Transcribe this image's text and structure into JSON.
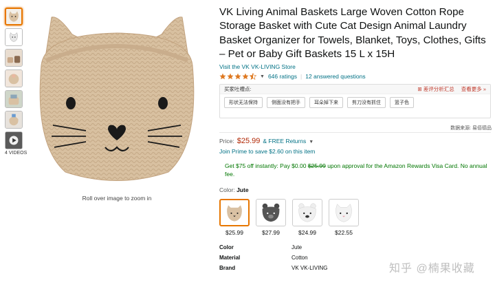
{
  "thumbnails": {
    "count": 6,
    "video_label": "4 VIDEOS"
  },
  "main": {
    "zoom_hint": "Roll over image to zoom in"
  },
  "product": {
    "title": "VK Living Animal Baskets Large Woven Cotton Rope Storage Basket with Cute Cat Design Animal Laundry Basket Organizer for Towels, Blanket, Toys, Clothes, Gifts – Pet or Baby Gift Baskets 15 L x 15H",
    "store_link": "Visit the VK VK-LIVING Store",
    "rating_value": 4.5,
    "ratings_count": "646 ratings",
    "answered": "12 answered questions"
  },
  "cn_panel": {
    "title": "买家吐槽点:",
    "link1": "⊞ 差评分析汇总",
    "link2": "查看更多 »",
    "tags": [
      "形状无法保持",
      "侧面没有把手",
      "耳朵掉下来",
      "剪刀没有抓住",
      "篮子色"
    ],
    "source": "数据来源: 易佰德品"
  },
  "pricing": {
    "label": "Price:",
    "price": "$25.99",
    "free_returns": "& FREE Returns",
    "prime": "Join Prime to save $2.60 on this item",
    "offer_pre": "Get $75 off instantly: Pay $0.00",
    "offer_strike": "$25.99",
    "offer_post": "upon approval for the Amazon Rewards Visa Card. No annual fee."
  },
  "color": {
    "label": "Color:",
    "selected": "Jute",
    "swatches": [
      {
        "price": "$25.99"
      },
      {
        "price": "$27.99"
      },
      {
        "price": "$24.99"
      },
      {
        "price": "$22.55"
      }
    ]
  },
  "specs": [
    {
      "key": "Color",
      "value": "Jute"
    },
    {
      "key": "Material",
      "value": "Cotton"
    },
    {
      "key": "Brand",
      "value": "VK VK-LIVING"
    }
  ],
  "watermark": "知乎 @楠果收藏",
  "colors": {
    "link": "#007185",
    "price": "#b12704",
    "offer": "#007600",
    "selected_border": "#e77600",
    "jute": "#d9c1a3"
  }
}
